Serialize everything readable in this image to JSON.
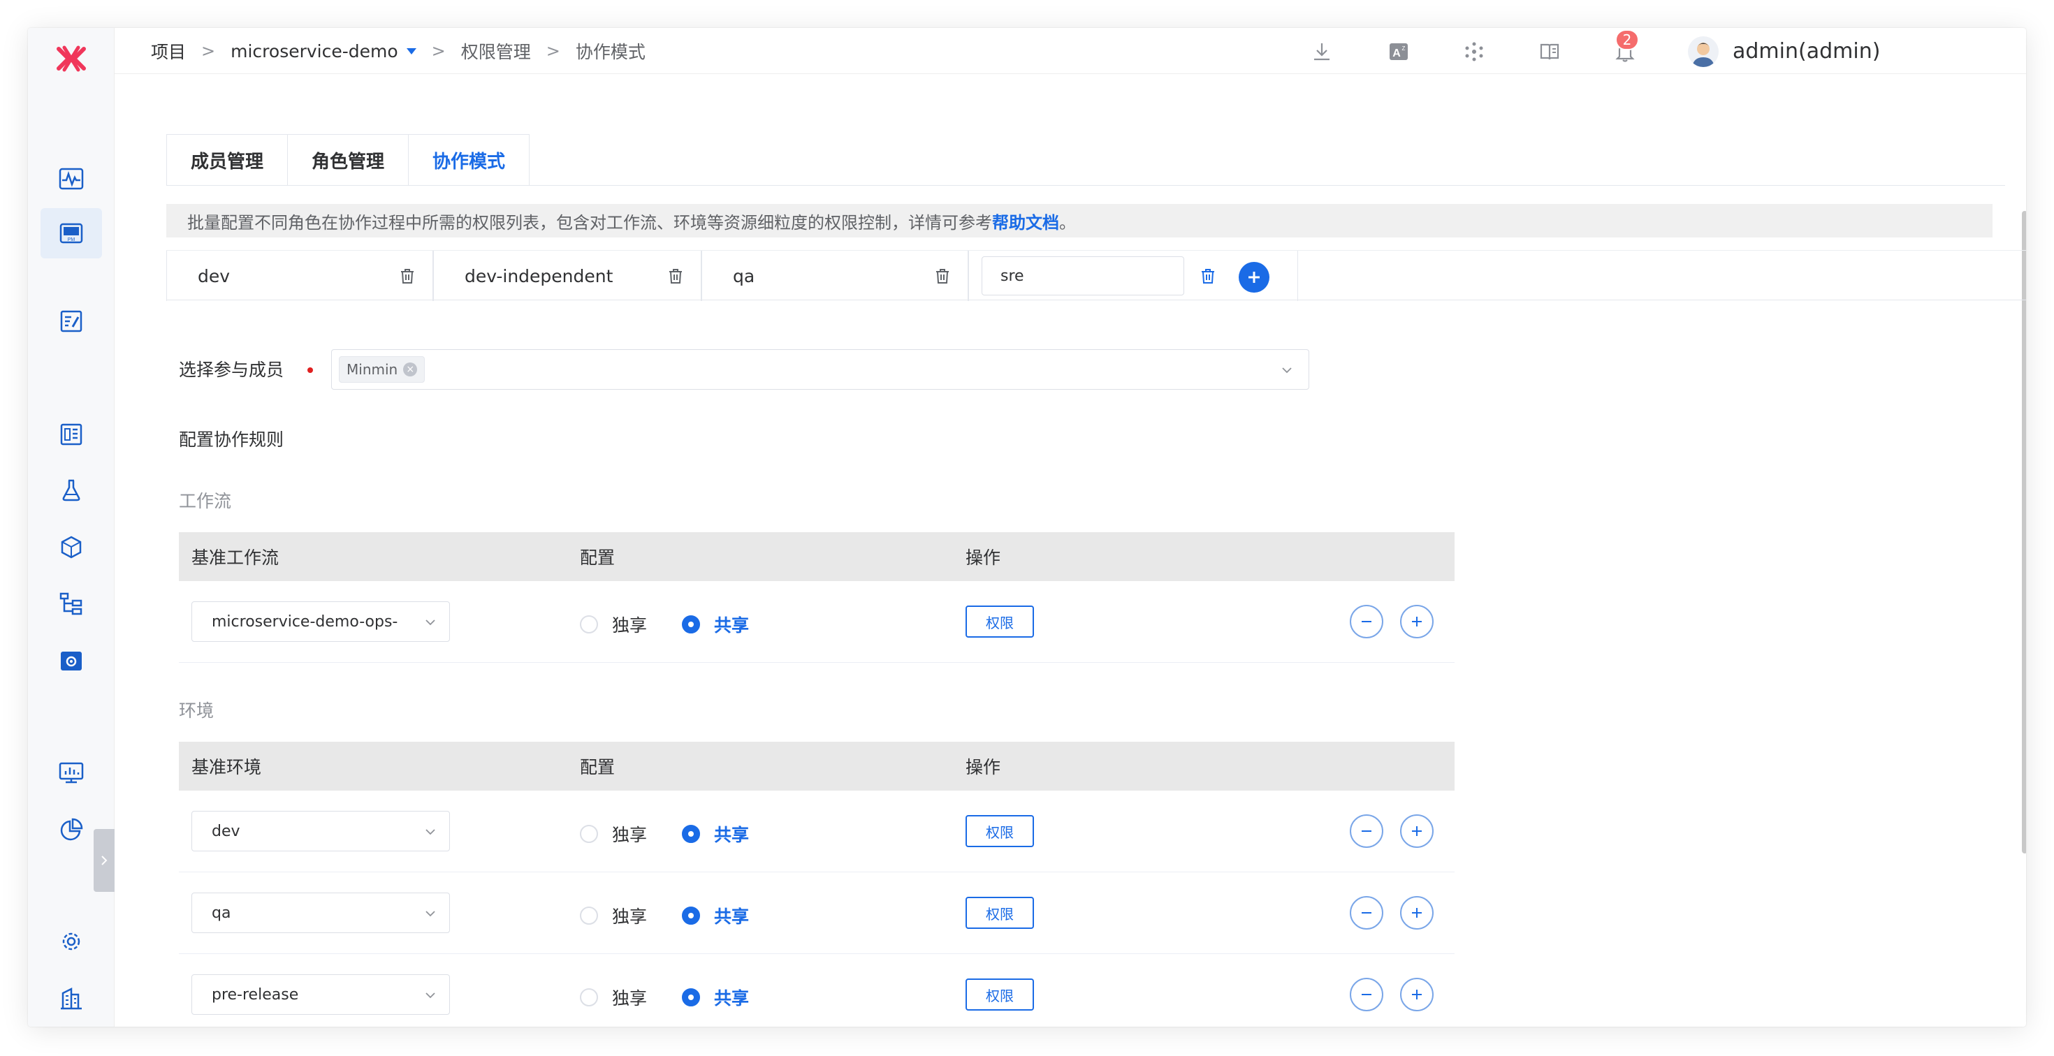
{
  "breadcrumb": {
    "project": "项目",
    "project_name": "microservice-demo",
    "permission": "权限管理",
    "collab": "协作模式",
    "separator": ">"
  },
  "header": {
    "notification_count": "2",
    "username": "admin(admin)"
  },
  "tabs": [
    {
      "label": "成员管理",
      "active": false
    },
    {
      "label": "角色管理",
      "active": false
    },
    {
      "label": "协作模式",
      "active": true
    }
  ],
  "notice": {
    "text": "批量配置不同角色在协作过程中所需的权限列表，包含对工作流、环境等资源细粒度的权限控制，详情可参考",
    "link": "帮助文档",
    "suffix": "。"
  },
  "roles": [
    "dev",
    "dev-independent",
    "qa"
  ],
  "role_input_value": "sre",
  "members": {
    "label": "选择参与成员",
    "tags": [
      "Minmin"
    ]
  },
  "rules": {
    "title": "配置协作规则",
    "workflow_title": "工作流",
    "env_title": "环境",
    "workflow_table": {
      "headers": [
        "基准工作流",
        "配置",
        "操作"
      ],
      "rows": [
        {
          "value": "microservice-demo-ops-",
          "mode": "shared"
        }
      ]
    },
    "env_table": {
      "headers": [
        "基准环境",
        "配置",
        "操作"
      ],
      "rows": [
        {
          "value": "dev",
          "mode": "shared"
        },
        {
          "value": "qa",
          "mode": "shared"
        },
        {
          "value": "pre-release",
          "mode": "shared"
        }
      ]
    },
    "exclusive_label": "独享",
    "shared_label": "共享",
    "permission_label": "权限"
  },
  "colors": {
    "accent": "#1a6be6",
    "logo": "#f0365a",
    "badge": "#f56c6c"
  },
  "icons": {
    "sidebar": [
      "pulse-icon",
      "pm-icon",
      "edit-doc-icon",
      "dashboard-icon",
      "flask-icon",
      "package-icon",
      "tree-icon",
      "settings-box-icon",
      "monitor-icon",
      "pie-chart-icon",
      "gear-icon",
      "building-icon"
    ],
    "top": [
      "download-icon",
      "translate-icon",
      "cluster-icon",
      "book-icon",
      "bell-icon"
    ]
  }
}
